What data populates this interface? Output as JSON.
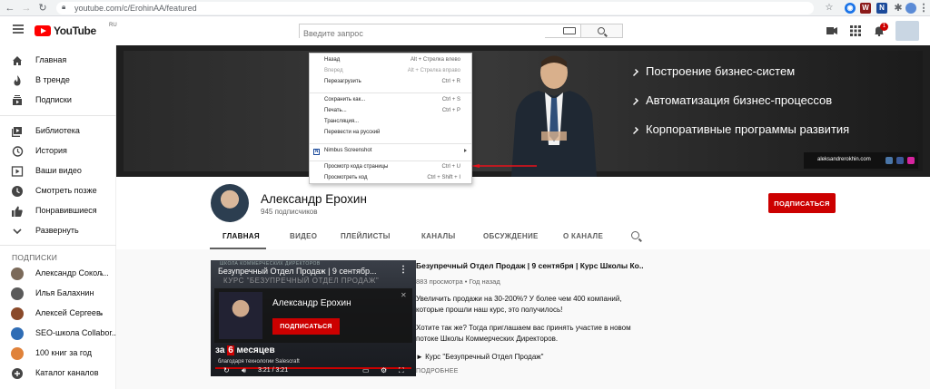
{
  "browser": {
    "url": "youtube.com/c/ErohinAA/featured"
  },
  "header": {
    "logo_text": "YouTube",
    "logo_region": "RU",
    "search_placeholder": "Введите запрос",
    "notification_count": "1"
  },
  "sidebar": {
    "items": [
      {
        "label": "Главная",
        "icon": "home-icon"
      },
      {
        "label": "В тренде",
        "icon": "fire-icon"
      },
      {
        "label": "Подписки",
        "icon": "subscriptions-icon"
      },
      {
        "label": "Библиотека",
        "icon": "library-icon"
      },
      {
        "label": "История",
        "icon": "history-icon"
      },
      {
        "label": "Ваши видео",
        "icon": "your-videos-icon"
      },
      {
        "label": "Смотреть позже",
        "icon": "watch-later-icon"
      },
      {
        "label": "Понравившиеся",
        "icon": "thumb-up-icon"
      },
      {
        "label": "Развернуть",
        "icon": "chevron-down-icon"
      }
    ],
    "subscriptions_title": "ПОДПИСКИ",
    "subscriptions": [
      {
        "label": "Александр Сокол...",
        "color": "#7b6a5a",
        "dot": true
      },
      {
        "label": "Илья Балахнин",
        "color": "#5a5a5a",
        "dot": false
      },
      {
        "label": "Алексей Сергеев",
        "color": "#8a4a2a",
        "dot": true
      },
      {
        "label": "SEO-школа Collabor...",
        "color": "#2f6db5",
        "dot": false
      },
      {
        "label": "100 книг за год",
        "color": "#e0823a",
        "dot": false
      },
      {
        "label": "Каталог каналов",
        "color": "#606060",
        "dot": false
      }
    ]
  },
  "banner": {
    "lines": [
      "Построение бизнес-систем",
      "Автоматизация бизнес-процессов",
      "Корпоративные программы развития"
    ],
    "site": "aleksandrerokhin.com"
  },
  "channel": {
    "name": "Александр Ерохин",
    "subscribers": "945 подписчиков",
    "subscribe_label": "ПОДПИСАТЬСЯ",
    "tabs": [
      "ГЛАВНАЯ",
      "ВИДЕО",
      "ПЛЕЙЛИСТЫ",
      "КАНАЛЫ",
      "ОБСУЖДЕНИЕ",
      "О КАНАЛЕ"
    ]
  },
  "featured_video": {
    "player_title": "Безупречный Отдел Продаж | 9 сентябр...",
    "bg_text_1": "ШКОЛА КОММЕРЧЕСКИХ ДИРЕКТОРОВ",
    "bg_text_2": "КУРС \"БЕЗУПРЕЧНЫЙ ОТДЕЛ ПРОДАЖ\"",
    "card_name": "Александр Ерохин",
    "card_button": "ПОДПИСАТЬСЯ",
    "overlay_line_1_a": "за ",
    "overlay_line_1_b": "6",
    "overlay_line_1_c": " месяцев",
    "overlay_line_2": "благодаря технологии Salescraft",
    "time": "3:21 / 3:21",
    "title": "Безупречный Отдел Продаж | 9 сентября | Курс Школы Ко...",
    "meta": "883 просмотра • Год назад",
    "description_1": "Увеличить продажи на 30-200%? У более чем 400 компаний, которые прошли наш курс, это получилось!",
    "description_2": "Хотите так же? Тогда приглашаем вас принять участие в новом потоке Школы Коммерческих Директоров.",
    "description_3": "► Курс \"Безупречный Отдел Продаж\"",
    "more_label": "ПОДРОБНЕЕ"
  },
  "context_menu": {
    "items": [
      {
        "label": "Назад",
        "shortcut": "Alt + Стрелка влево",
        "disabled": false
      },
      {
        "label": "Вперед",
        "shortcut": "Alt + Стрелка вправо",
        "disabled": true
      },
      {
        "label": "Перезагрузить",
        "shortcut": "Ctrl + R",
        "disabled": false
      },
      {
        "label": "Сохранить как...",
        "shortcut": "Ctrl + S",
        "disabled": false
      },
      {
        "label": "Печать...",
        "shortcut": "Ctrl + P",
        "disabled": false
      },
      {
        "label": "Трансляция...",
        "shortcut": "",
        "disabled": false
      },
      {
        "label": "Перевести на русский",
        "shortcut": "",
        "disabled": false
      },
      {
        "label": "Nimbus Screenshot",
        "shortcut": "",
        "disabled": false
      },
      {
        "label": "Просмотр кода страницы",
        "shortcut": "Ctrl + U",
        "disabled": false
      },
      {
        "label": "Просмотреть код",
        "shortcut": "Ctrl + Shift + I",
        "disabled": false
      }
    ]
  },
  "colors": {
    "brand_red": "#ff0000",
    "subscribe_red": "#cc0000",
    "annotation_arrow": "#e8101a"
  }
}
